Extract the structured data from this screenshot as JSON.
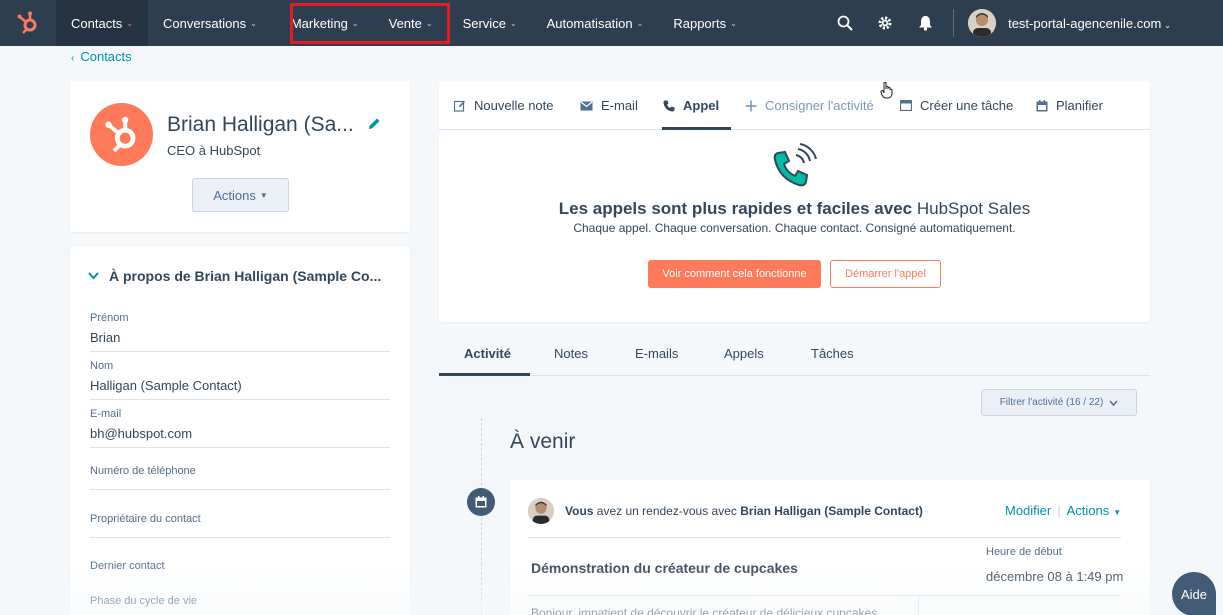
{
  "nav": {
    "logo_icon": "hubspot-sprocket-icon",
    "items": [
      {
        "label": "Contacts",
        "active": true
      },
      {
        "label": "Conversations",
        "active": false
      },
      {
        "label": "Marketing",
        "active": false
      },
      {
        "label": "Vente",
        "active": false
      },
      {
        "label": "Service",
        "active": false
      },
      {
        "label": "Automatisation",
        "active": false
      },
      {
        "label": "Rapports",
        "active": false
      }
    ],
    "portal": "test-portal-agencenile.com",
    "icons": [
      "search-icon",
      "gear-icon",
      "bell-icon"
    ]
  },
  "breadcrumb": "Contacts",
  "profile": {
    "name": "Brian Halligan (Sa...",
    "title": "CEO à HubSpot",
    "actions_label": "Actions"
  },
  "about": {
    "header": "À propos de Brian Halligan (Sample Co...",
    "fields": [
      {
        "label": "Prénom",
        "value": "Brian"
      },
      {
        "label": "Nom",
        "value": "Halligan (Sample Contact)"
      },
      {
        "label": "E-mail",
        "value": "bh@hubspot.com"
      },
      {
        "label": "Numéro de téléphone",
        "value": ""
      },
      {
        "label": "Propriétaire du contact",
        "value": ""
      },
      {
        "label": "Dernier contact",
        "value": ""
      },
      {
        "label": "Phase du cycle de vie",
        "value": ""
      }
    ]
  },
  "composer": {
    "tabs": [
      {
        "label": "Nouvelle note",
        "icon": "pencil-note-icon"
      },
      {
        "label": "E-mail",
        "icon": "envelope-icon"
      },
      {
        "label": "Appel",
        "icon": "phone-icon"
      },
      {
        "label": "Consigner l'activité",
        "icon": "plus-icon"
      },
      {
        "label": "Créer une tâche",
        "icon": "task-icon"
      },
      {
        "label": "Planifier",
        "icon": "calendar-icon"
      }
    ],
    "active_tab": "Appel",
    "promo_title_bold": "Les appels sont plus rapides et faciles avec",
    "promo_title_rest": "HubSpot Sales",
    "promo_subtitle": "Chaque appel. Chaque conversation. Chaque contact. Consigné automatiquement.",
    "primary_button": "Voir comment cela fonctionne",
    "secondary_button": "Démarrer l'appel"
  },
  "activity": {
    "tabs": [
      "Activité",
      "Notes",
      "E-mails",
      "Appels",
      "Tâches"
    ],
    "active_tab": "Activité",
    "filter_label": "Filtrer l'activité (16 / 22)",
    "section_heading": "À venir",
    "event": {
      "prefix_bold": "Vous",
      "middle": "avez un rendez-vous avec",
      "contact_bold": "Brian Halligan (Sample Contact)",
      "modify_label": "Modifier",
      "actions_label": "Actions",
      "title": "Démonstration du créateur de cupcakes",
      "start_label": "Heure de début",
      "start_value": "décembre 08 à 1:49 pm",
      "body_preview": "Bonjour, impatient de découvrir le créateur de délicieux cupcakes"
    }
  },
  "help_label": "Aide",
  "colors": {
    "nav_bg": "#2d3e50",
    "accent_orange": "#ff7a59",
    "link_teal": "#0091ae",
    "highlight_red": "#e31b23"
  }
}
